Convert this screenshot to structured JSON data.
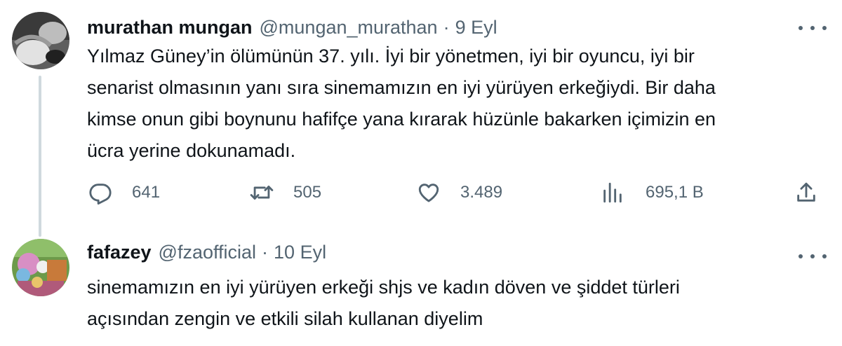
{
  "tweets": [
    {
      "author_name": "murathan mungan",
      "handle": "@mungan_murathan",
      "separator": "·",
      "date": "9 Eyl",
      "text_lines": [
        "Yılmaz Güney’in ölümünün 37.  yılı. İyi bir yönetmen, iyi bir oyuncu, iyi bir",
        "senarist olmasının yanı sıra sinemamızın en iyi yürüyen erkeğiydi. Bir daha",
        "kimse onun gibi boynunu hafifçe yana kırarak hüzünle bakarken içimizin en",
        "ücra yerine dokunamadı."
      ],
      "replies": "641",
      "retweets": "505",
      "likes": "3.489",
      "views": "695,1 B",
      "icons": {
        "avatar": "bw-photo-avatar",
        "more": "more-icon",
        "reply": "reply-icon",
        "retweet": "retweet-icon",
        "like": "heart-icon",
        "views": "views-icon",
        "share": "share-icon"
      }
    },
    {
      "author_name": "fafazey",
      "handle": "@fzaofficial",
      "separator": "·",
      "date": "10 Eyl",
      "text_lines": [
        "sinemamızın en iyi yürüyen erkeği shjs ve kadın döven ve şiddet türleri",
        "açısından zengin ve etkili silah kullanan diyelim"
      ],
      "icons": {
        "avatar": "colorful-avatar",
        "more": "more-icon"
      }
    }
  ],
  "colors": {
    "text": "#0f1419",
    "secondary": "#536471",
    "thread_line": "#cfd9de"
  }
}
